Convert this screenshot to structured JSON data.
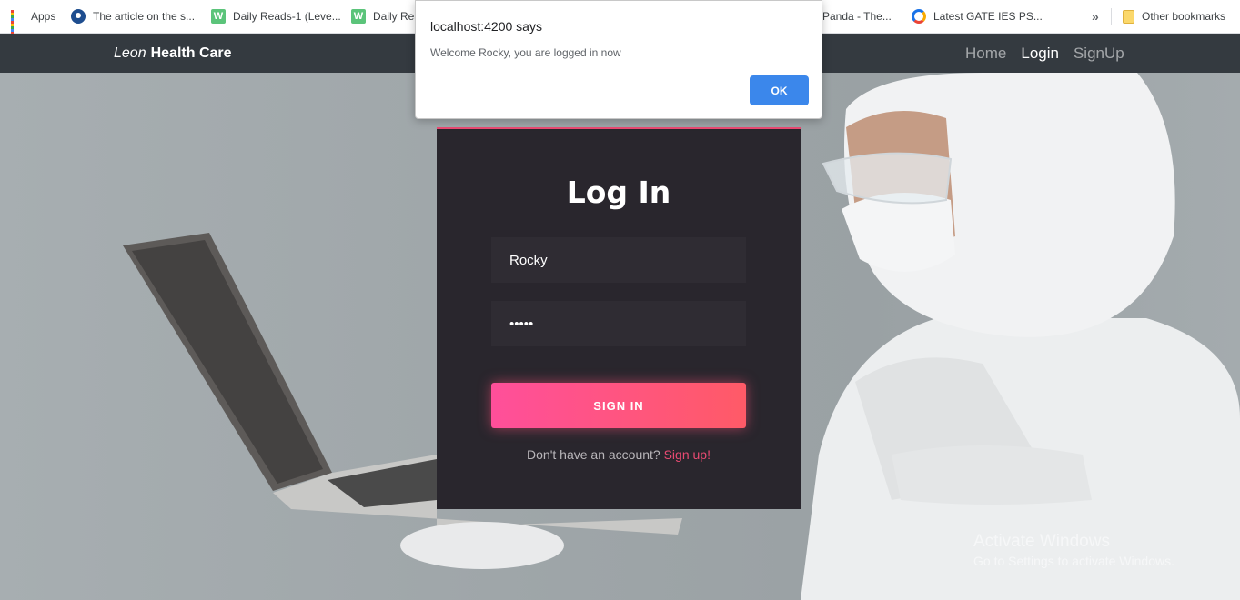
{
  "bookmarks": {
    "apps_label": "Apps",
    "items": [
      {
        "label": "The article on the s...",
        "icon": "globe-icon"
      },
      {
        "label": "Daily Reads-1 (Leve...",
        "icon": "w-icon"
      },
      {
        "label": "Daily Rea",
        "icon": "w-icon"
      },
      {
        "label": "Panda - The...",
        "icon": ""
      },
      {
        "label": "Latest GATE IES PS...",
        "icon": "g-icon"
      }
    ],
    "overflow_label": "»",
    "other_label": "Other bookmarks"
  },
  "navbar": {
    "brand_italic": "Leon",
    "brand_bold": "Health Care",
    "links": [
      {
        "label": "Home",
        "active": false
      },
      {
        "label": "Login",
        "active": true
      },
      {
        "label": "SignUp",
        "active": false
      }
    ]
  },
  "login": {
    "title": "Log In",
    "username_value": "Rocky",
    "password_value": "•••••",
    "button_label": "SIGN IN",
    "signup_prompt": "Don't have an account?",
    "signup_link": "Sign up!"
  },
  "dialog": {
    "title": "localhost:4200 says",
    "message": "Welcome Rocky, you are logged in now",
    "ok_label": "OK"
  },
  "watermark": {
    "line1": "Activate Windows",
    "line2": "Go to Settings to activate Windows."
  },
  "colors": {
    "accent": "#e94a72",
    "button_gradient_start": "#ff4f9a",
    "button_gradient_end": "#ff5a67",
    "navbar_bg": "#343a40",
    "card_bg": "#29262d",
    "dialog_ok": "#1a73e8"
  }
}
